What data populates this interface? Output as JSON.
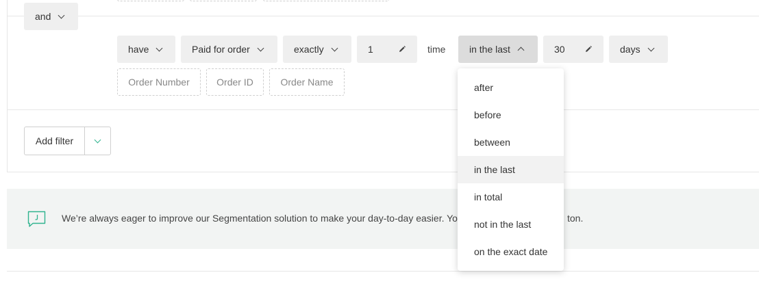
{
  "condition": {
    "join_label": "and",
    "have_label": "have",
    "event_label": "Paid for order",
    "quantifier_label": "exactly",
    "count_value": "1",
    "time_word": "time",
    "period_label": "in the last",
    "period_value": "30",
    "unit_label": "days",
    "property_chips": [
      "Order Number",
      "Order ID",
      "Order Name"
    ]
  },
  "add_filter": {
    "label": "Add filter"
  },
  "notice": {
    "text": "We’re always eager to improve our Segmentation solution to make your day-to-day easier. Your",
    "text_tail": "ton."
  },
  "period_menu": {
    "options": [
      "after",
      "before",
      "between",
      "in the last",
      "in total",
      "not in the last",
      "on the exact date"
    ],
    "selected": "in the last"
  },
  "colors": {
    "accent": "#2fb38e",
    "chip_bg": "#efefef",
    "chip_active_bg": "#dcdcdc"
  },
  "icons": [
    "chevron-down-icon",
    "chevron-up-icon",
    "pencil-icon",
    "feedback-icon"
  ]
}
